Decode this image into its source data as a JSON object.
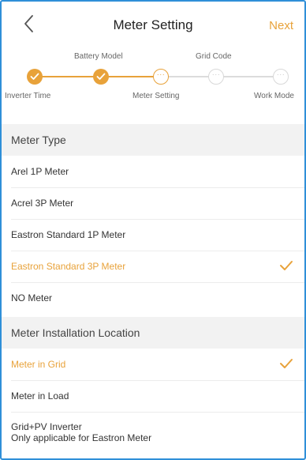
{
  "header": {
    "title": "Meter Setting",
    "next_label": "Next"
  },
  "stepper": {
    "top_labels": [
      "Battery Model",
      "Grid Code"
    ],
    "bottom_labels": [
      "Inverter Time",
      "Meter Setting",
      "Work Mode"
    ],
    "ellipsis": "···"
  },
  "meter_type": {
    "heading": "Meter Type",
    "options": [
      "Arel 1P Meter",
      "Acrel 3P Meter",
      "Eastron Standard 1P Meter",
      "Eastron Standard 3P Meter",
      "NO Meter"
    ],
    "selected": "Eastron Standard 3P Meter"
  },
  "meter_location": {
    "heading": "Meter Installation Location",
    "options": [
      {
        "label": "Meter in Grid",
        "sub": ""
      },
      {
        "label": "Meter in Load",
        "sub": ""
      },
      {
        "label": "Grid+PV Inverter",
        "sub": "Only applicable for Eastron Meter"
      }
    ],
    "selected": "Meter in Grid"
  },
  "colors": {
    "accent": "#e8a23a",
    "section_bg": "#f2f2f2",
    "frame_border": "#2f8fd8"
  }
}
